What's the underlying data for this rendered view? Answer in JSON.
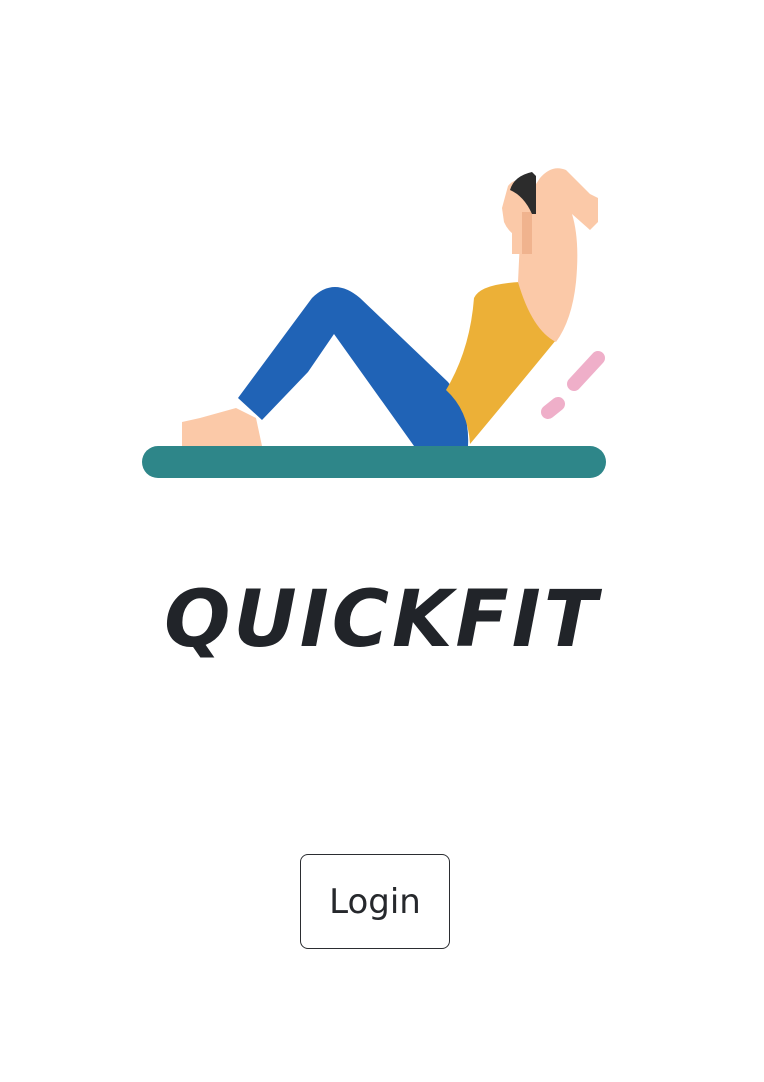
{
  "app": {
    "brand_name": "QUICKFIT"
  },
  "hero": {
    "illustration": "person-doing-crunch-on-mat",
    "colors": {
      "mat": "#2e8689",
      "pants": "#2063b6",
      "shirt": "#ecb037",
      "skin": "#fbc9a8",
      "hair": "#2c2c2c",
      "motion_lines": "#efafc9"
    }
  },
  "auth": {
    "login_label": "Login"
  }
}
